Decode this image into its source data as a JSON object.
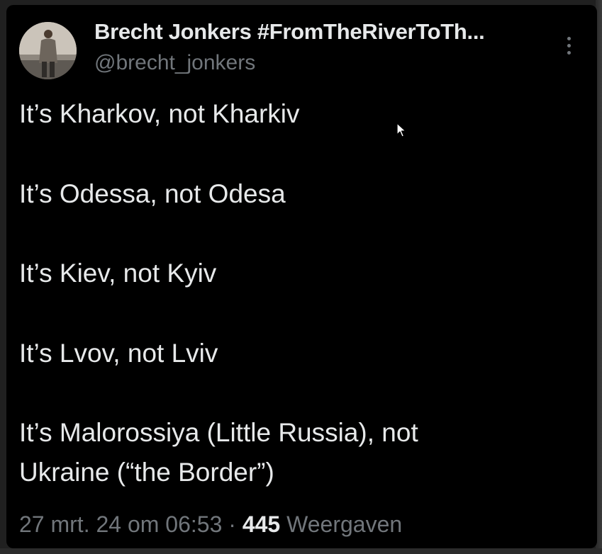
{
  "author": {
    "display_name": "Brecht Jonkers #FromTheRiverToTh...",
    "handle": "@brecht_jonkers"
  },
  "tweet": {
    "lines": [
      "It’s Kharkov, not Kharkiv",
      "It’s Odessa, not Odesa",
      "It’s Kiev, not Kyiv",
      "It’s Lvov, not Lviv",
      "It’s Malorossiya (Little Russia), not",
      "Ukraine (“the Border”)"
    ]
  },
  "meta": {
    "timestamp": "27 mrt. 24 om 06:53",
    "separator": "·",
    "views_count": "445",
    "views_label": "Weergaven"
  },
  "icons": {
    "more": "more-vertical-icon",
    "cursor": "mouse-pointer-icon"
  },
  "colors": {
    "background": "#000000",
    "primary_text": "#e7e9ea",
    "secondary_text": "#71767b"
  }
}
